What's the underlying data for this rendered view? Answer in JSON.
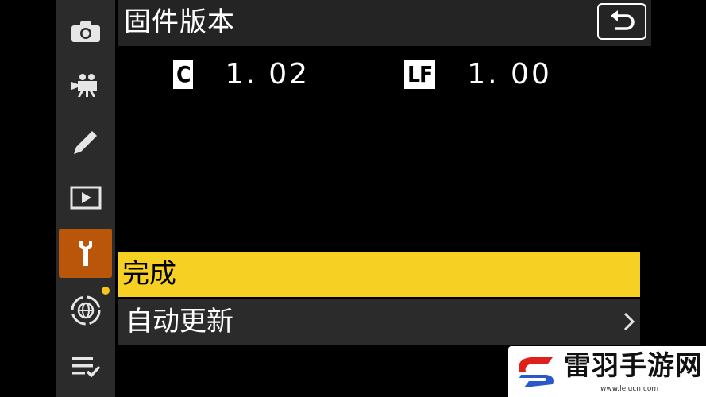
{
  "header": {
    "title": "固件版本"
  },
  "versions": [
    {
      "badge": "C",
      "value": "1. 02"
    },
    {
      "badge": "LF",
      "value": "1. 00"
    }
  ],
  "menu": {
    "done_label": "完成",
    "auto_update_label": "自动更新"
  },
  "sidebar": {
    "items": [
      "camera-icon",
      "movie-icon",
      "pencil-icon",
      "playback-icon",
      "wrench-icon",
      "network-icon",
      "my-menu-icon"
    ],
    "active": "wrench-icon"
  },
  "watermark": {
    "text": "雷羽手游网",
    "url": "www.leiucn.com"
  },
  "colors": {
    "highlight": "#f6d022",
    "active_tab": "#b9560a",
    "sidebar_bg": "#2b2b2b"
  }
}
